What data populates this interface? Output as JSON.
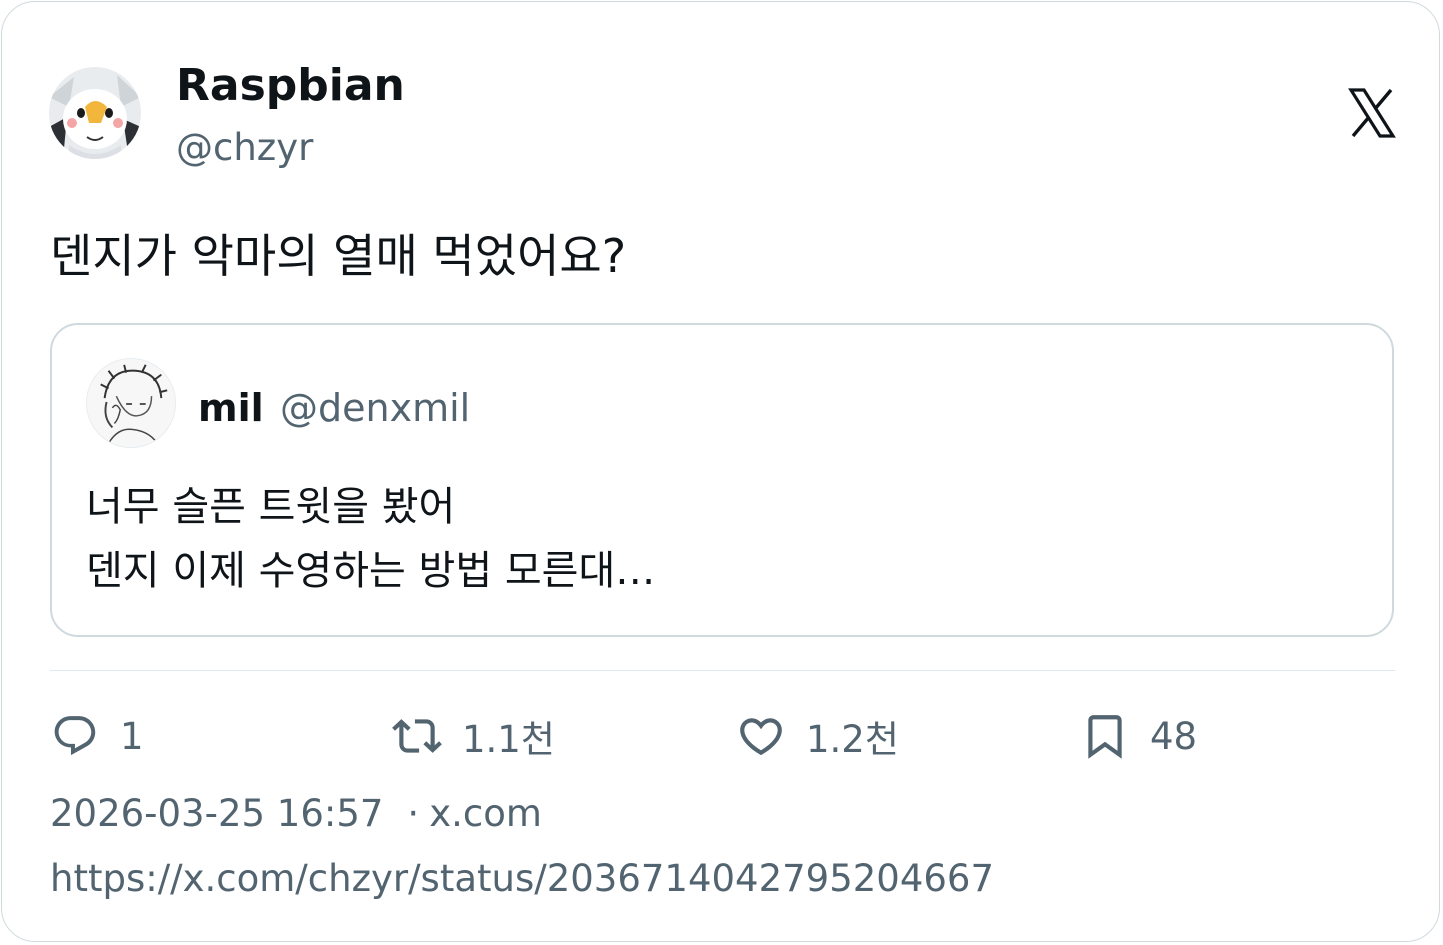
{
  "tweet": {
    "author_name": "Raspbian",
    "author_handle": "@chzyr",
    "text": "덴지가 악마의 열매 먹었어요?"
  },
  "quoted_tweet": {
    "author_name": "mil",
    "author_handle": "@denxmil",
    "line1": "너무 슬픈 트윗을 봤어",
    "line2": "덴지 이제 수영하는 방법 모른대…"
  },
  "actions": {
    "replies": "1",
    "retweets": "1.1천",
    "likes": "1.2천",
    "bookmarks": "48"
  },
  "meta": {
    "timestamp": "2026-03-25 16:57",
    "separator": "·",
    "source": "x.com",
    "url": "https://x.com/chzyr/status/2036714042795204667"
  },
  "icons": {
    "brand": "x-logo-icon",
    "reply": "reply-icon",
    "retweet": "retweet-icon",
    "like": "heart-icon",
    "bookmark": "bookmark-icon"
  },
  "colors": {
    "text": "#0f1419",
    "secondary": "#536471",
    "border": "#cfd9de"
  }
}
